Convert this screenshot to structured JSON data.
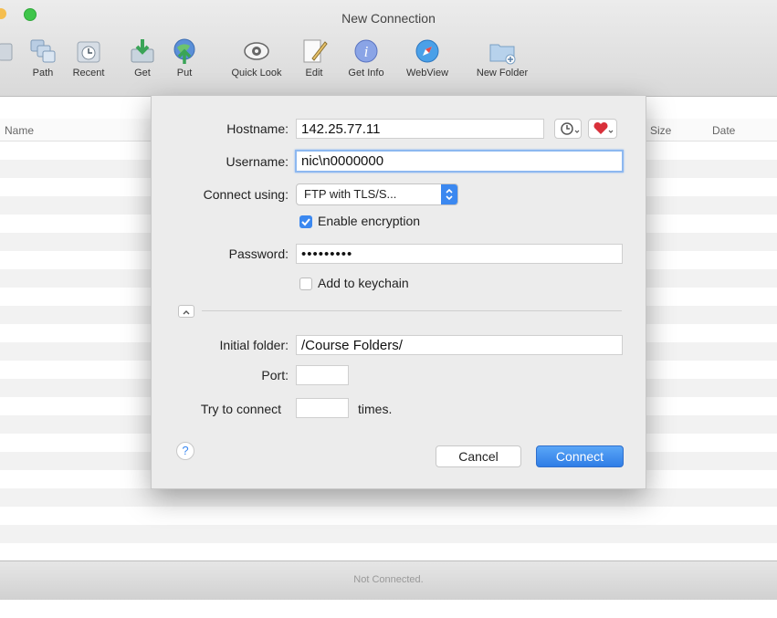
{
  "window": {
    "title": "New Connection",
    "status": "Not Connected."
  },
  "toolbar": {
    "items": [
      {
        "label": "Path",
        "icon": "path-icon"
      },
      {
        "label": "Recent",
        "icon": "recent-icon"
      },
      {
        "label": "Get",
        "icon": "get-icon"
      },
      {
        "label": "Put",
        "icon": "put-icon"
      },
      {
        "label": "Quick Look",
        "icon": "quick-look-icon"
      },
      {
        "label": "Edit",
        "icon": "edit-icon"
      },
      {
        "label": "Get Info",
        "icon": "get-info-icon"
      },
      {
        "label": "WebView",
        "icon": "webview-icon"
      },
      {
        "label": "New Folder",
        "icon": "new-folder-icon"
      }
    ]
  },
  "browser": {
    "columns": [
      "Name",
      "Size",
      "Date"
    ]
  },
  "dialog": {
    "hostname_label": "Hostname:",
    "hostname_value": "142.25.77.11",
    "username_label": "Username:",
    "username_value": "nic\\n0000000",
    "connect_using_label": "Connect using:",
    "connect_using_value": "FTP with TLS/S...",
    "enable_encryption_label": "Enable encryption",
    "enable_encryption_checked": true,
    "password_label": "Password:",
    "password_value": "•••••••••",
    "add_to_keychain_label": "Add to keychain",
    "add_to_keychain_checked": false,
    "initial_folder_label": "Initial folder:",
    "initial_folder_value": "/Course Folders/",
    "port_label": "Port:",
    "port_value": "",
    "try_connect_label": "Try to connect",
    "try_connect_value": "",
    "times_label": "times.",
    "help_label": "?",
    "cancel_label": "Cancel",
    "connect_label": "Connect"
  },
  "colors": {
    "accent": "#3b88f0",
    "favorite": "#d9303a",
    "sheet_background": "#ececec"
  }
}
